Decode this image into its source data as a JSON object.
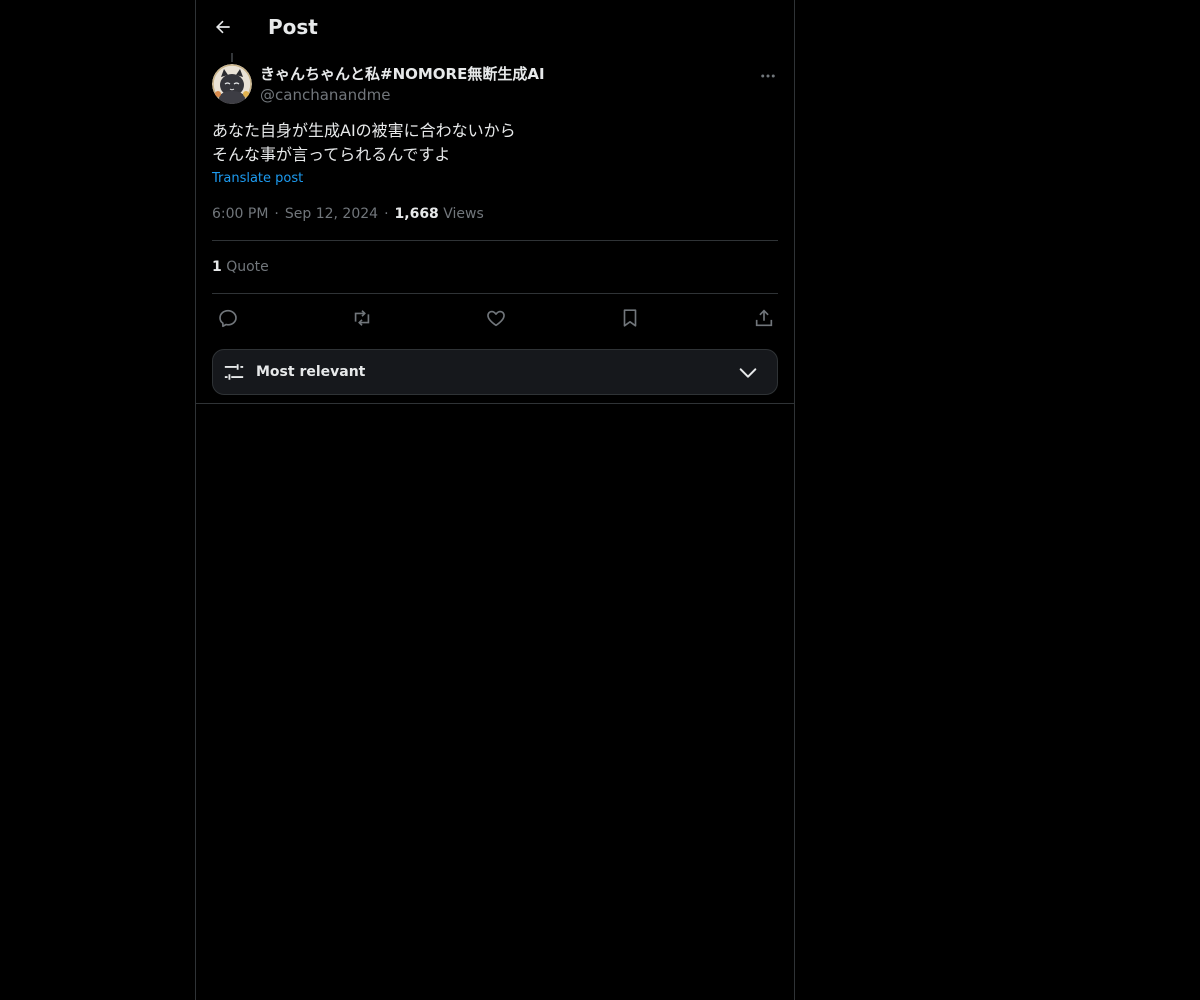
{
  "header": {
    "title": "Post",
    "back_icon": "arrow-left-icon"
  },
  "post": {
    "author": {
      "display_name": "きゃんちゃんと私#NOMORE無断生成AI",
      "handle": "@canchanandme",
      "avatar": "cat-avatar"
    },
    "text_lines": [
      "あなた自身が生成AIの被害に合わないから",
      "そんな事が言ってられるんですよ"
    ],
    "translate_label": "Translate post",
    "time": "6:00 PM",
    "date": "Sep 12, 2024",
    "separator": "·",
    "views_count": "1,668",
    "views_label": "Views",
    "quote_count": "1",
    "quote_label": "Quote"
  },
  "actions": [
    {
      "name": "reply",
      "icon": "reply-icon"
    },
    {
      "name": "repost",
      "icon": "repost-icon"
    },
    {
      "name": "like",
      "icon": "heart-icon"
    },
    {
      "name": "bookmark",
      "icon": "bookmark-icon"
    },
    {
      "name": "share",
      "icon": "share-icon"
    }
  ],
  "sort": {
    "label": "Most relevant",
    "icon": "filter-sliders-icon"
  },
  "colors": {
    "background": "#000000",
    "text_primary": "#e7e9ea",
    "text_secondary": "#71767b",
    "link": "#1d9bf0",
    "border": "#2f3336"
  }
}
